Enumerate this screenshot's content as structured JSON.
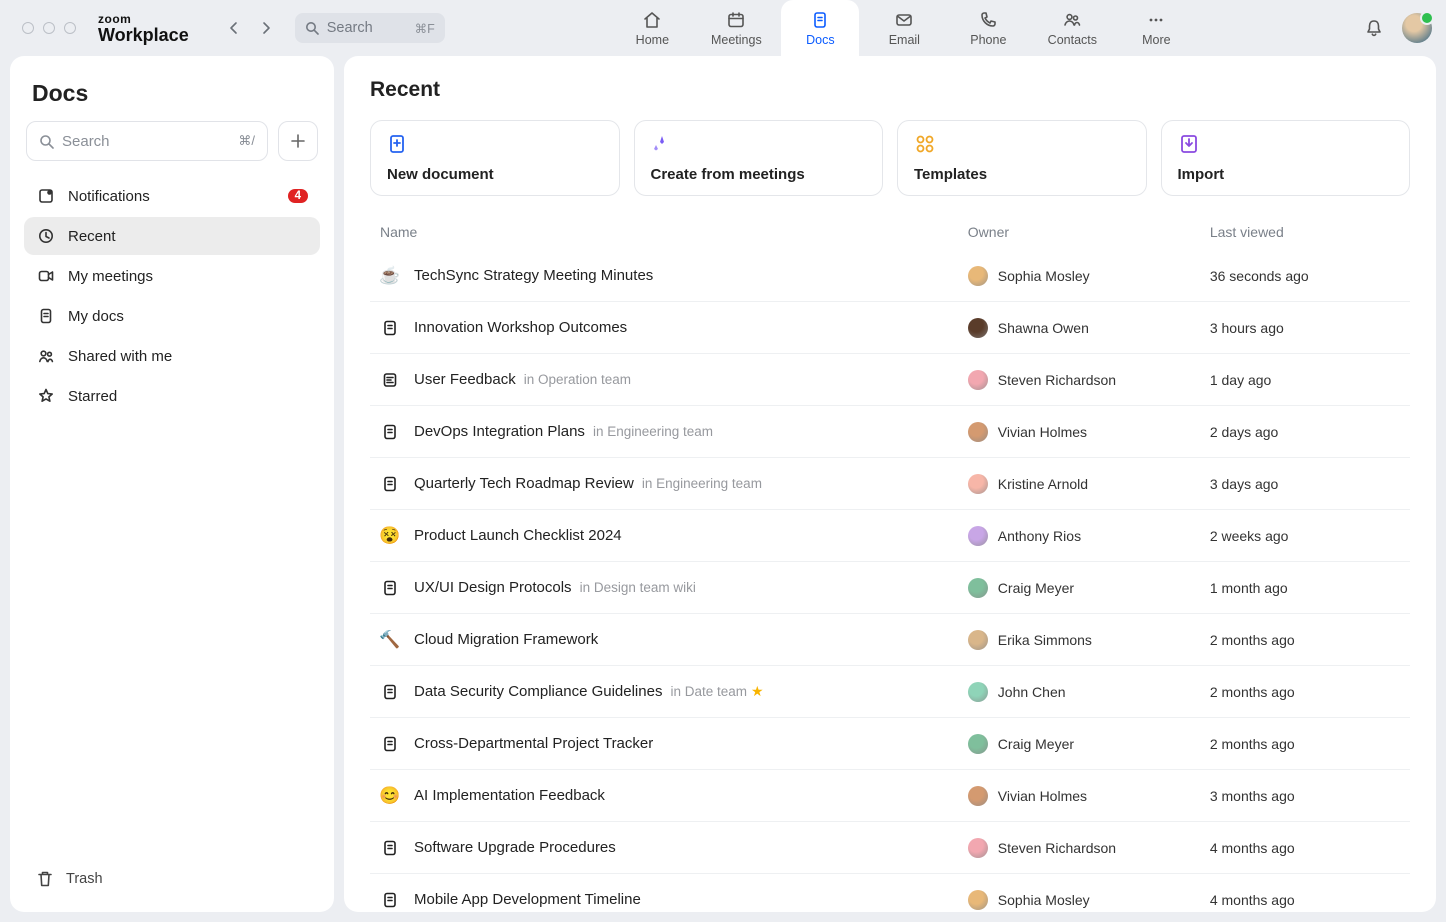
{
  "brand": {
    "line1": "zoom",
    "line2": "Workplace"
  },
  "globalSearch": {
    "placeholder": "Search",
    "shortcut": "⌘F"
  },
  "topNav": [
    {
      "id": "home",
      "label": "Home"
    },
    {
      "id": "meetings",
      "label": "Meetings"
    },
    {
      "id": "docs",
      "label": "Docs"
    },
    {
      "id": "email",
      "label": "Email"
    },
    {
      "id": "phone",
      "label": "Phone"
    },
    {
      "id": "contacts",
      "label": "Contacts"
    },
    {
      "id": "more",
      "label": "More"
    }
  ],
  "activeTopNav": "docs",
  "sidebar": {
    "title": "Docs",
    "search_placeholder": "Search",
    "search_shortcut": "⌘/",
    "items": [
      {
        "id": "notifications",
        "label": "Notifications",
        "badge": "4"
      },
      {
        "id": "recent",
        "label": "Recent"
      },
      {
        "id": "my-meetings",
        "label": "My meetings"
      },
      {
        "id": "my-docs",
        "label": "My docs"
      },
      {
        "id": "shared",
        "label": "Shared with me"
      },
      {
        "id": "starred",
        "label": "Starred"
      }
    ],
    "activeItem": "recent",
    "trash_label": "Trash"
  },
  "main": {
    "title": "Recent",
    "actions": [
      {
        "id": "new-doc",
        "label": "New document",
        "color": "#2563f0"
      },
      {
        "id": "from-meetings",
        "label": "Create from meetings",
        "color": "#7a5cf5"
      },
      {
        "id": "templates",
        "label": "Templates",
        "color": "#f0a727"
      },
      {
        "id": "import",
        "label": "Import",
        "color": "#8a4ae0"
      }
    ],
    "columns": {
      "name": "Name",
      "owner": "Owner",
      "last": "Last viewed"
    },
    "docs": [
      {
        "name": "TechSync Strategy Meeting Minutes",
        "icon": "cup",
        "owner": "Sophia Mosley",
        "ownerColor": "#e8b878",
        "last": "36 seconds ago"
      },
      {
        "name": "Innovation Workshop Outcomes",
        "icon": "doc",
        "owner": "Shawna Owen",
        "ownerColor": "#5a3c2a",
        "last": "3 hours ago"
      },
      {
        "name": "User Feedback",
        "location": "in Operation team",
        "icon": "form",
        "owner": "Steven Richardson",
        "ownerColor": "#f2a7b0",
        "last": "1 day ago"
      },
      {
        "name": "DevOps Integration Plans",
        "location": "in Engineering team",
        "icon": "doc",
        "owner": "Vivian Holmes",
        "ownerColor": "#d49a70",
        "last": "2 days ago"
      },
      {
        "name": "Quarterly Tech Roadmap Review",
        "location": "in Engineering team",
        "icon": "doc",
        "owner": "Kristine Arnold",
        "ownerColor": "#f7b6a8",
        "last": "3 days ago"
      },
      {
        "name": "Product Launch Checklist 2024",
        "icon": "face",
        "owner": "Anthony Rios",
        "ownerColor": "#c8a6e6",
        "last": "2 weeks ago"
      },
      {
        "name": "UX/UI Design Protocols",
        "location": "in Design team wiki",
        "icon": "doc",
        "owner": "Craig Meyer",
        "ownerColor": "#7fbf9c",
        "last": "1 month ago"
      },
      {
        "name": "Cloud Migration Framework",
        "icon": "hammer",
        "owner": "Erika Simmons",
        "ownerColor": "#d9b68a",
        "last": "2 months ago"
      },
      {
        "name": "Data Security Compliance Guidelines",
        "location": "in Date team",
        "starred": true,
        "icon": "doc",
        "owner": "John Chen",
        "ownerColor": "#8fd4b8",
        "last": "2 months ago"
      },
      {
        "name": "Cross-Departmental Project Tracker",
        "icon": "doc",
        "owner": "Craig Meyer",
        "ownerColor": "#7fbf9c",
        "last": "2 months ago"
      },
      {
        "name": "AI Implementation Feedback",
        "icon": "smile",
        "owner": "Vivian Holmes",
        "ownerColor": "#d49a70",
        "last": "3 months ago"
      },
      {
        "name": "Software Upgrade Procedures",
        "icon": "doc",
        "owner": "Steven Richardson",
        "ownerColor": "#f2a7b0",
        "last": "4 months ago"
      },
      {
        "name": "Mobile App Development Timeline",
        "icon": "doc",
        "owner": "Sophia Mosley",
        "ownerColor": "#e8b878",
        "last": "4 months ago"
      }
    ]
  }
}
